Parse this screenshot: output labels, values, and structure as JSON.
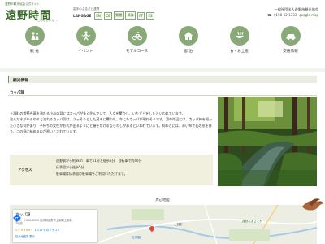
{
  "header": {
    "association": "遠野市観光協会公式サイト",
    "title": "遠野時間",
    "subtitle": "〜とおのじかん〜",
    "tagline": "岩手のふるさと遠野",
    "lang_label": "LANGAGE",
    "languages": [
      "EN",
      "CE",
      "繁體",
      "简体",
      "FT",
      "ES"
    ],
    "org": "一般社団法人遠野市観光協会",
    "phone": "0198-62-1333",
    "map_link": "google map"
  },
  "nav": [
    {
      "label": "観 光",
      "icon": "people-icon"
    },
    {
      "label": "イベント",
      "icon": "festival-icon"
    },
    {
      "label": "モデルコース",
      "icon": "bicycle-icon"
    },
    {
      "label": "宿 泊",
      "icon": "house-icon"
    },
    {
      "label": "食・お土産",
      "icon": "food-icon"
    },
    {
      "label": "交通情報",
      "icon": "car-icon"
    }
  ],
  "page": {
    "section_title": "観光情報",
    "spot_title": "カッパ淵",
    "description": "土淵町の常堅寺裏を流れる小川の淵にはカッパが多く住んでいて、人々を驚かし、いたずらをしたといわれています。\n淀んだ水がゆるゆると流れるカッパ淵は、うっそうとした茂みに覆われ、今にもカッパが現れそうです。淵の岸辺には、カッパ神を祀った小さな祠があり、子持ちの女性がお乳が出るようにと願をかけるならわしがあるといわれています。祠わきには、赤い布で乳の形を作り、この祠に納めるのが習いとされています。",
    "access_label": "アクセス",
    "access_lines": [
      "遠野駅から約8km　車で11分と徒歩5分　自転車で約40分",
      "伝承園から徒歩5分",
      "駐車場は伝承園の駐車場をご利用いただけます。"
    ]
  },
  "map": {
    "title": "周辺地図",
    "place_name": "カッパ淵",
    "address": "日本、〒028-0515 岩手県遠野市土淵町土淵第7地割",
    "rating": "4.0 ★★★★☆",
    "reviews": "1,111 件のクチコミ",
    "larger_link": "拡大地図を表示",
    "labels": [
      "土淵町",
      "伝承園",
      "遠野ふるさと村"
    ]
  }
}
